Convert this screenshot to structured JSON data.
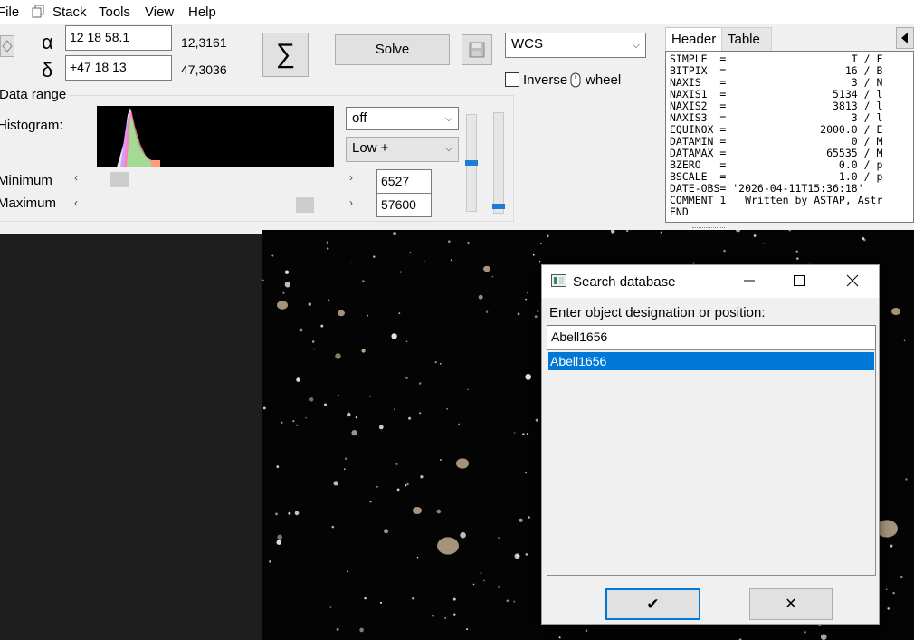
{
  "menu": {
    "file": "File",
    "stack": "Stack",
    "tools": "Tools",
    "view": "View",
    "help": "Help"
  },
  "coords": {
    "alpha_symbol": "α",
    "delta_symbol": "δ",
    "ra_value": "12 18 58.1",
    "dec_value": "+47 18 13",
    "ra_decimal": "12,3161",
    "dec_decimal": "47,3036",
    "sum_symbol": "∑"
  },
  "toolbar": {
    "solve_label": "Solve",
    "wcs_value": "WCS",
    "inverse_label": "Inverse",
    "wheel_label": "wheel"
  },
  "data_range": {
    "title": "Data range",
    "histogram_label": "Histogram:",
    "minimum_label": "Minimum",
    "maximum_label": "Maximum",
    "minimum_value": "6527",
    "maximum_value": "57600",
    "stretch_value": "off",
    "range_value": "Low +"
  },
  "header_tabs": {
    "header": "Header",
    "table": "Table"
  },
  "fits_header": [
    "SIMPLE  =                    T / F",
    "BITPIX  =                   16 / B",
    "NAXIS   =                    3 / N",
    "NAXIS1  =                 5134 / l",
    "NAXIS2  =                 3813 / l",
    "NAXIS3  =                    3 / l",
    "EQUINOX =               2000.0 / E",
    "DATAMIN =                    0 / M",
    "DATAMAX =                65535 / M",
    "BZERO   =                  0.0 / p",
    "BSCALE  =                  1.0 / p",
    "DATE-OBS= '2026-04-11T15:36:18'",
    "COMMENT 1   Written by ASTAP, Astr",
    "END"
  ],
  "dialog": {
    "title": "Search database",
    "prompt": "Enter object designation or position:",
    "input_value": "Abell1656",
    "result_item": "Abell1656",
    "ok_glyph": "✔",
    "cancel_glyph": "✕"
  },
  "colors": {
    "selection": "#0078d7",
    "accent_slider": "#1f7bd6"
  }
}
